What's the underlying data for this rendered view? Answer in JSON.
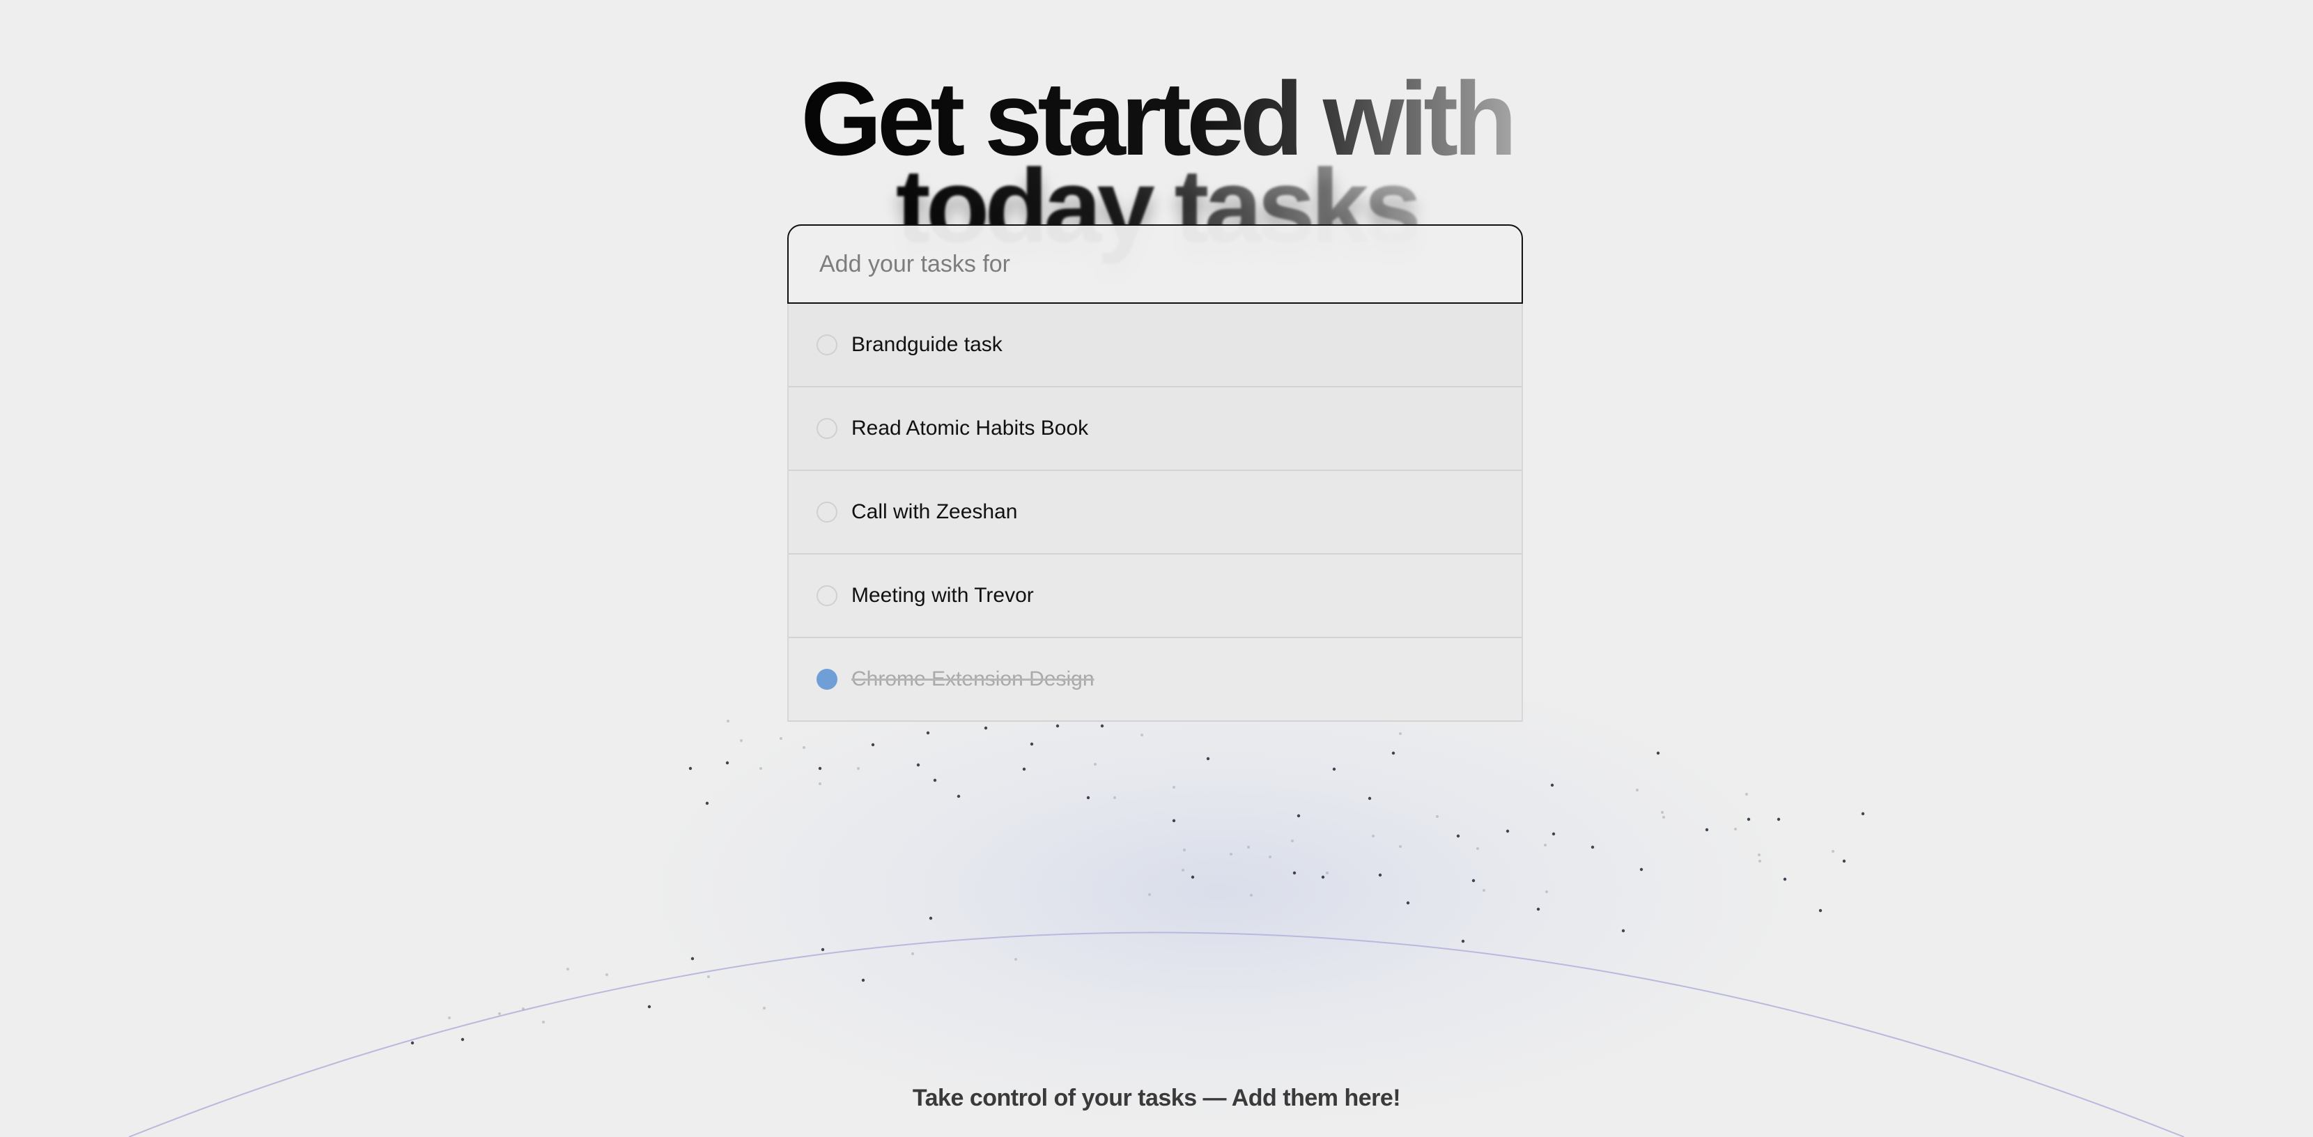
{
  "hero": {
    "headline_line_1": "Get started with",
    "headline_line_2": "today tasks"
  },
  "task_input": {
    "placeholder": "Add your tasks for",
    "value": ""
  },
  "tasks": [
    {
      "label": "Brandguide task",
      "completed": false
    },
    {
      "label": "Read Atomic Habits Book",
      "completed": false
    },
    {
      "label": "Call with Zeeshan",
      "completed": false
    },
    {
      "label": "Meeting with Trevor",
      "completed": false
    },
    {
      "label": "Chrome Extension Design",
      "completed": true
    }
  ],
  "footer": {
    "tagline": "Take control of your tasks — Add them here!"
  },
  "colors": {
    "background": "#eeeeee",
    "completed_check": "#6f9fd6",
    "arc_stroke": "#b9b8dd",
    "headline_dark": "#050505",
    "headline_fade": "#a4a4a4"
  }
}
